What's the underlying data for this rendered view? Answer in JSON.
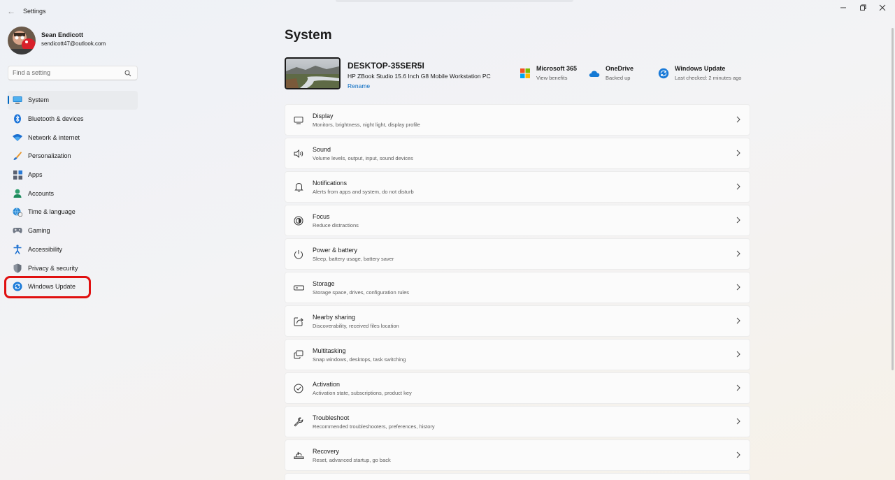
{
  "window": {
    "title": "Settings"
  },
  "profile": {
    "name": "Sean Endicott",
    "email": "sendicott47@outlook.com"
  },
  "search": {
    "placeholder": "Find a setting"
  },
  "sidebar": {
    "items": [
      {
        "label": "System",
        "icon": "monitor-icon",
        "active": true
      },
      {
        "label": "Bluetooth & devices",
        "icon": "bluetooth-icon"
      },
      {
        "label": "Network & internet",
        "icon": "wifi-icon"
      },
      {
        "label": "Personalization",
        "icon": "paintbrush-icon"
      },
      {
        "label": "Apps",
        "icon": "apps-icon"
      },
      {
        "label": "Accounts",
        "icon": "person-icon"
      },
      {
        "label": "Time & language",
        "icon": "globe-clock-icon"
      },
      {
        "label": "Gaming",
        "icon": "gamepad-icon"
      },
      {
        "label": "Accessibility",
        "icon": "accessibility-icon"
      },
      {
        "label": "Privacy & security",
        "icon": "shield-icon"
      },
      {
        "label": "Windows Update",
        "icon": "update-icon",
        "highlighted": true
      }
    ]
  },
  "page": {
    "title": "System"
  },
  "device": {
    "name": "DESKTOP-35SER5I",
    "model": "HP ZBook Studio 15.6 Inch G8 Mobile Workstation PC",
    "rename_label": "Rename"
  },
  "status": {
    "m365": {
      "title": "Microsoft 365",
      "sub": "View benefits"
    },
    "onedrive": {
      "title": "OneDrive",
      "sub": "Backed up"
    },
    "update": {
      "title": "Windows Update",
      "sub": "Last checked: 2 minutes ago"
    }
  },
  "settings": [
    {
      "title": "Display",
      "sub": "Monitors, brightness, night light, display profile",
      "icon": "display-icon"
    },
    {
      "title": "Sound",
      "sub": "Volume levels, output, input, sound devices",
      "icon": "speaker-icon"
    },
    {
      "title": "Notifications",
      "sub": "Alerts from apps and system, do not disturb",
      "icon": "bell-icon"
    },
    {
      "title": "Focus",
      "sub": "Reduce distractions",
      "icon": "focus-icon"
    },
    {
      "title": "Power & battery",
      "sub": "Sleep, battery usage, battery saver",
      "icon": "power-icon"
    },
    {
      "title": "Storage",
      "sub": "Storage space, drives, configuration rules",
      "icon": "storage-icon"
    },
    {
      "title": "Nearby sharing",
      "sub": "Discoverability, received files location",
      "icon": "share-icon"
    },
    {
      "title": "Multitasking",
      "sub": "Snap windows, desktops, task switching",
      "icon": "multitask-icon"
    },
    {
      "title": "Activation",
      "sub": "Activation state, subscriptions, product key",
      "icon": "check-circle-icon"
    },
    {
      "title": "Troubleshoot",
      "sub": "Recommended troubleshooters, preferences, history",
      "icon": "wrench-icon"
    },
    {
      "title": "Recovery",
      "sub": "Reset, advanced startup, go back",
      "icon": "recovery-icon"
    }
  ],
  "colors": {
    "accent": "#0067c0",
    "highlight": "#e01010"
  }
}
